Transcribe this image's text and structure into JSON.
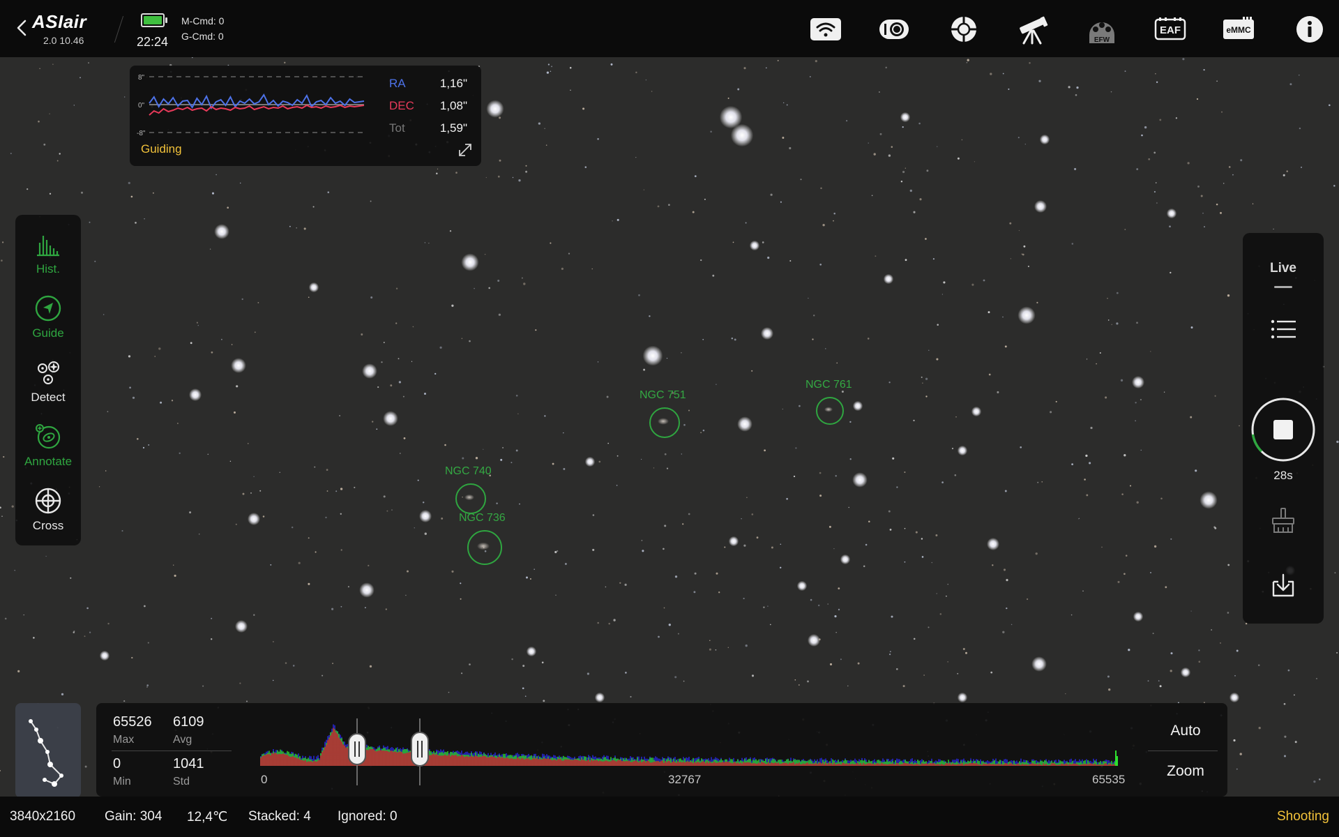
{
  "app": {
    "logo": "ASIair",
    "version": "2.0 10.46",
    "time": "22:24",
    "m_cmd": "M-Cmd: 0",
    "g_cmd": "G-Cmd: 0"
  },
  "top_icons": [
    {
      "name": "wifi-icon"
    },
    {
      "name": "camera-icon"
    },
    {
      "name": "guide-scope-icon"
    },
    {
      "name": "telescope-icon"
    },
    {
      "name": "efw-icon",
      "label": "EFW"
    },
    {
      "name": "eaf-icon",
      "label": "EAF"
    },
    {
      "name": "emmc-icon",
      "label": "eMMC"
    },
    {
      "name": "info-icon"
    }
  ],
  "guiding": {
    "title": "Guiding",
    "y_labels": [
      "8\"",
      "0\"",
      "-8\""
    ],
    "ra_label": "RA",
    "ra_value": "1,16\"",
    "dec_label": "DEC",
    "dec_value": "1,08\"",
    "tot_label": "Tot",
    "tot_value": "1,59\"",
    "ra_color": "#4d72e8",
    "dec_color": "#e83a5a",
    "ra_series": [
      0.4,
      2.2,
      -0.6,
      1.6,
      0.2,
      2.0,
      -0.4,
      1.0,
      1.2,
      -0.8,
      1.8,
      0.0,
      2.4,
      -1.0,
      0.8,
      1.4,
      -0.2,
      2.2,
      -0.6,
      1.0,
      0.4,
      1.6,
      0.2,
      0.8,
      2.8,
      0.0,
      1.2,
      -0.4,
      1.0,
      0.6,
      -0.2,
      1.4,
      0.4,
      2.6,
      -0.6,
      0.8,
      1.2,
      0.0,
      2.0,
      0.4,
      1.0,
      -0.2,
      1.6,
      0.6,
      0.8,
      1.0
    ],
    "dec_series": [
      -3.0,
      -1.8,
      -2.4,
      -1.2,
      -2.0,
      -1.6,
      -1.0,
      -1.4,
      -0.8,
      -1.6,
      -1.2,
      -1.0,
      -1.8,
      -0.6,
      -1.4,
      -1.0,
      -1.2,
      -1.6,
      -0.8,
      -1.2,
      -1.0,
      -0.4,
      -1.4,
      -1.0,
      -0.6,
      -1.2,
      -0.8,
      -1.0,
      -0.4,
      -1.2,
      -0.8,
      -0.6,
      -1.0,
      -0.2,
      -0.8,
      -0.6,
      -1.0,
      -0.4,
      -0.8,
      -0.6,
      -0.2,
      -0.8,
      -0.4,
      -0.6,
      -0.4,
      -0.2
    ]
  },
  "left_tools": [
    {
      "name": "hist",
      "label": "Hist.",
      "color": "#2fa640"
    },
    {
      "name": "guide",
      "label": "Guide",
      "color": "#2fa640"
    },
    {
      "name": "detect",
      "label": "Detect",
      "color": "#e8e8e8"
    },
    {
      "name": "annotate",
      "label": "Annotate",
      "color": "#2fa640"
    },
    {
      "name": "cross",
      "label": "Cross",
      "color": "#e8e8e8"
    }
  ],
  "right_panel": {
    "mode": "Live",
    "timer": "28s",
    "exposure_progress": 0.1
  },
  "annotations": [
    {
      "label": "NGC 751"
    },
    {
      "label": "NGC 761"
    },
    {
      "label": "NGC 740"
    },
    {
      "label": "NGC 736"
    }
  ],
  "histogram": {
    "max_value": "65526",
    "max_label": "Max",
    "avg_value": "6109",
    "avg_label": "Avg",
    "min_value": "0",
    "min_label": "Min",
    "std_value": "1041",
    "std_label": "Std",
    "x_ticks": [
      "0",
      "32767",
      "65535"
    ],
    "auto_label": "Auto",
    "zoom_label": "Zoom",
    "colors": {
      "green": "#2ee02e",
      "blue": "#2a2ae8",
      "red": "#e02a2a"
    }
  },
  "status": {
    "resolution": "3840x2160",
    "gain": "Gain: 304",
    "temperature": "12,4℃",
    "stacked": "Stacked: 4",
    "ignored": "Ignored: 0",
    "state": "Shooting"
  },
  "theme": {
    "accent_green": "#2fa640",
    "accent_yellow": "#f2c23a"
  }
}
